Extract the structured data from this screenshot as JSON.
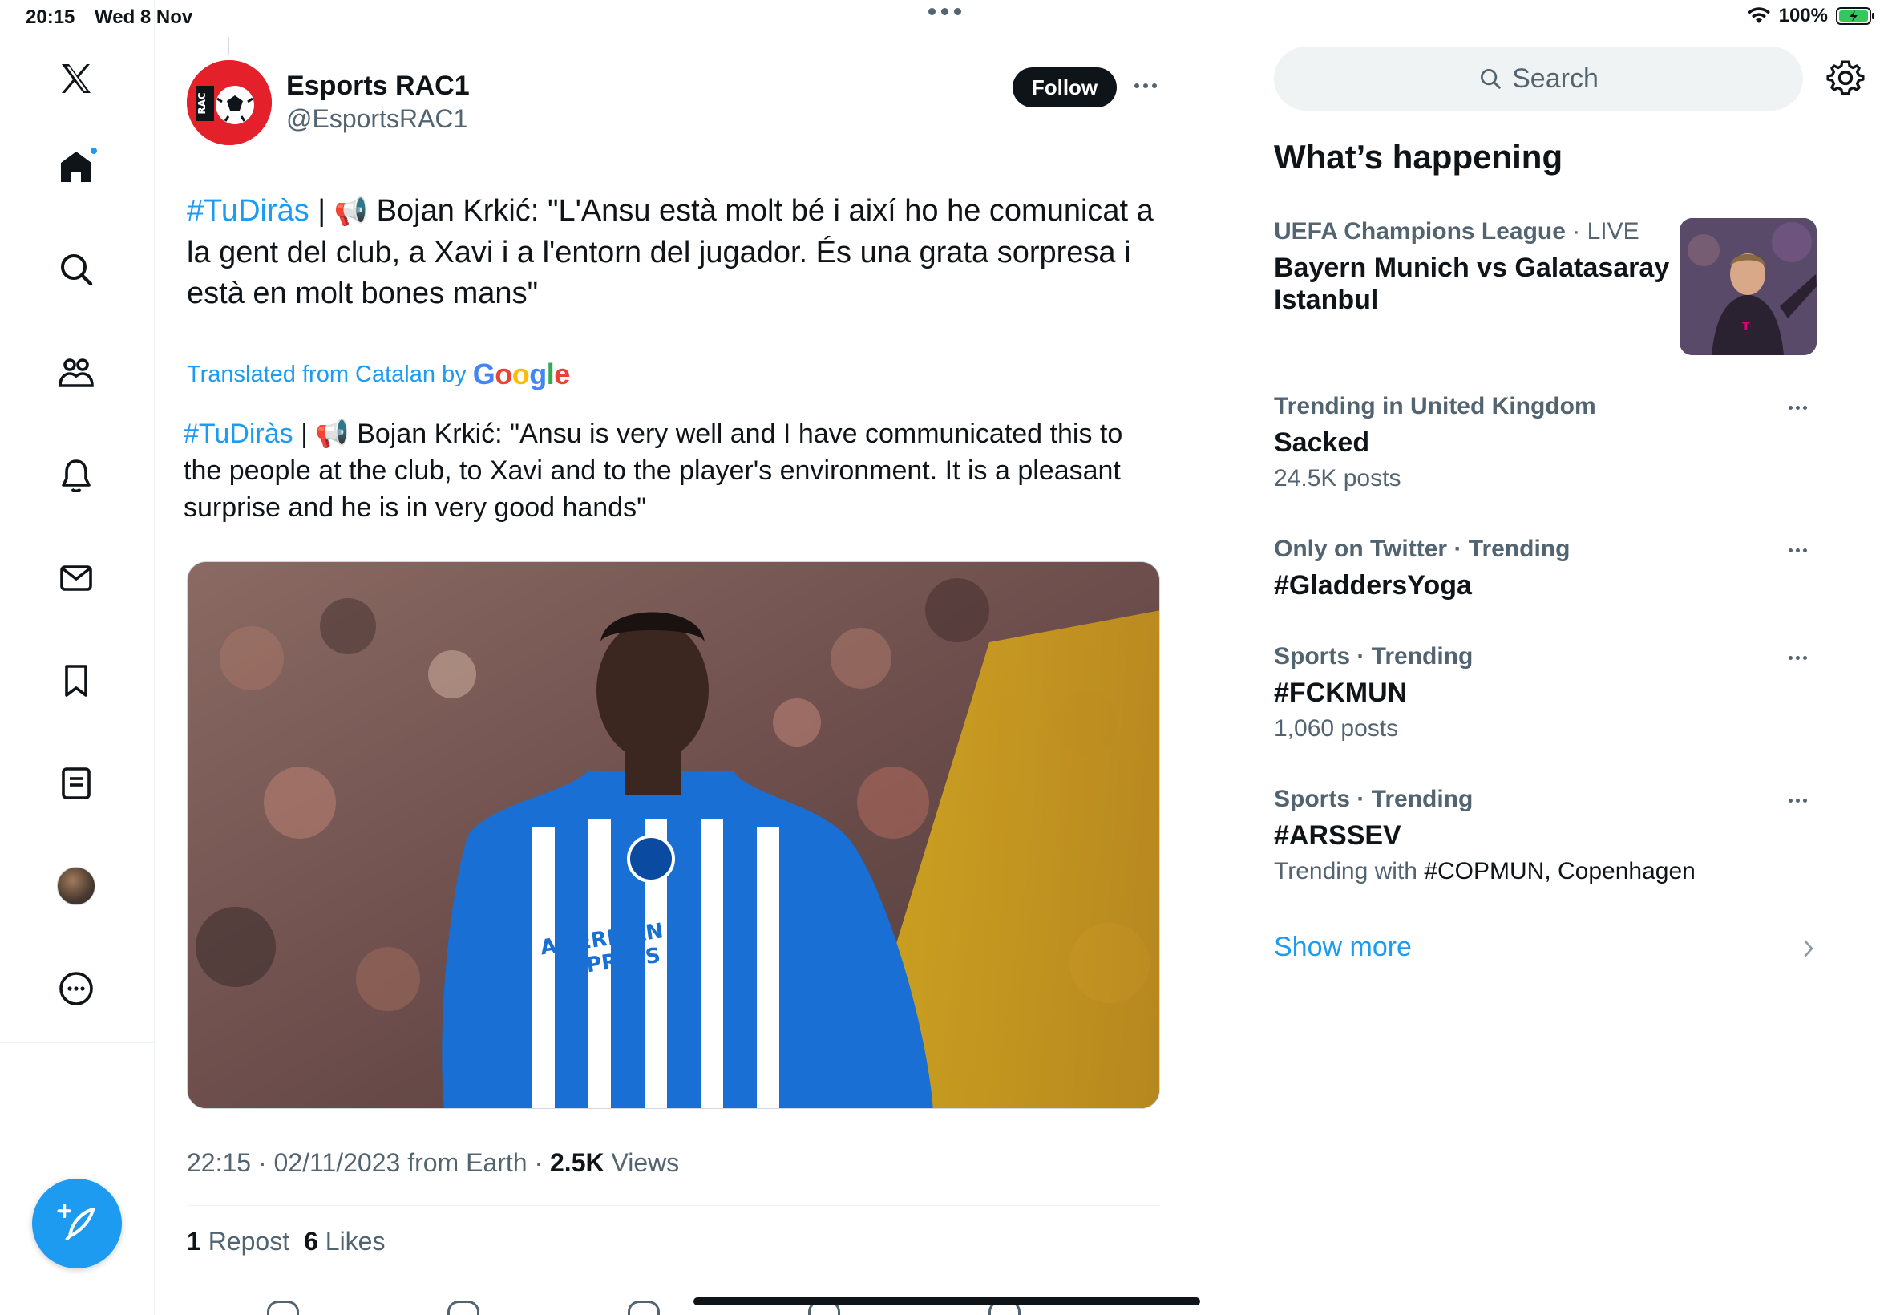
{
  "status_bar": {
    "time": "20:15",
    "date": "Wed 8 Nov",
    "battery": "100%"
  },
  "nav": {
    "icons": [
      "x-logo-icon",
      "home-icon",
      "search-icon",
      "communities-icon",
      "notifications-icon",
      "messages-icon",
      "bookmarks-icon",
      "lists-icon",
      "profile-avatar",
      "more-icon"
    ],
    "compose": "compose-icon"
  },
  "tweet": {
    "author_name": "Esports RAC1",
    "author_handle": "@EsportsRAC1",
    "follow_label": "Follow",
    "text_hashtag": "#TuDiràs",
    "text_separator": " | ",
    "text_body": " Bojan Krkić: \"L'Ansu està molt bé i així ho he comunicat a la gent del club, a Xavi i a l'entorn del jugador. És una grata sorpresa i està en molt bones mans\"",
    "translated_label": "Translated from Catalan by",
    "translation_hashtag": "#TuDiràs",
    "translation_separator": " | ",
    "translation_body": " Bojan Krkić: \"Ansu is very well and I have communicated this to the people at the club, to Xavi and to the player's environment. It is a pleasant surprise and he is in very good hands\"",
    "timestamp": "22:15 · 02/11/2023 from Earth · ",
    "views_count": "2.5K",
    "views_label": " Views",
    "reposts_count": "1",
    "reposts_label": " Repost",
    "likes_count": "6",
    "likes_label": " Likes"
  },
  "sidebar": {
    "search_placeholder": "Search",
    "section_title": "What’s happening",
    "trends": [
      {
        "category": "UEFA Champions League",
        "context": " · LIVE",
        "title": "Bayern Munich vs Galatasaray Istanbul"
      },
      {
        "category": "Trending in United Kingdom",
        "title": "Sacked",
        "sub": "24.5K posts"
      },
      {
        "category": "Only on Twitter · Trending",
        "title": "#GladdersYoga"
      },
      {
        "category": "Sports · Trending",
        "title": "#FCKMUN",
        "sub": "1,060 posts"
      },
      {
        "category": "Sports · Trending",
        "title": "#ARSSEV",
        "sub_prefix": "Trending with ",
        "sub_tags": "#COPMUN, Copenhagen"
      }
    ],
    "show_more": "Show more"
  },
  "colors": {
    "accent": "#1d9bf0",
    "text": "#0f1419",
    "muted": "#536471"
  }
}
